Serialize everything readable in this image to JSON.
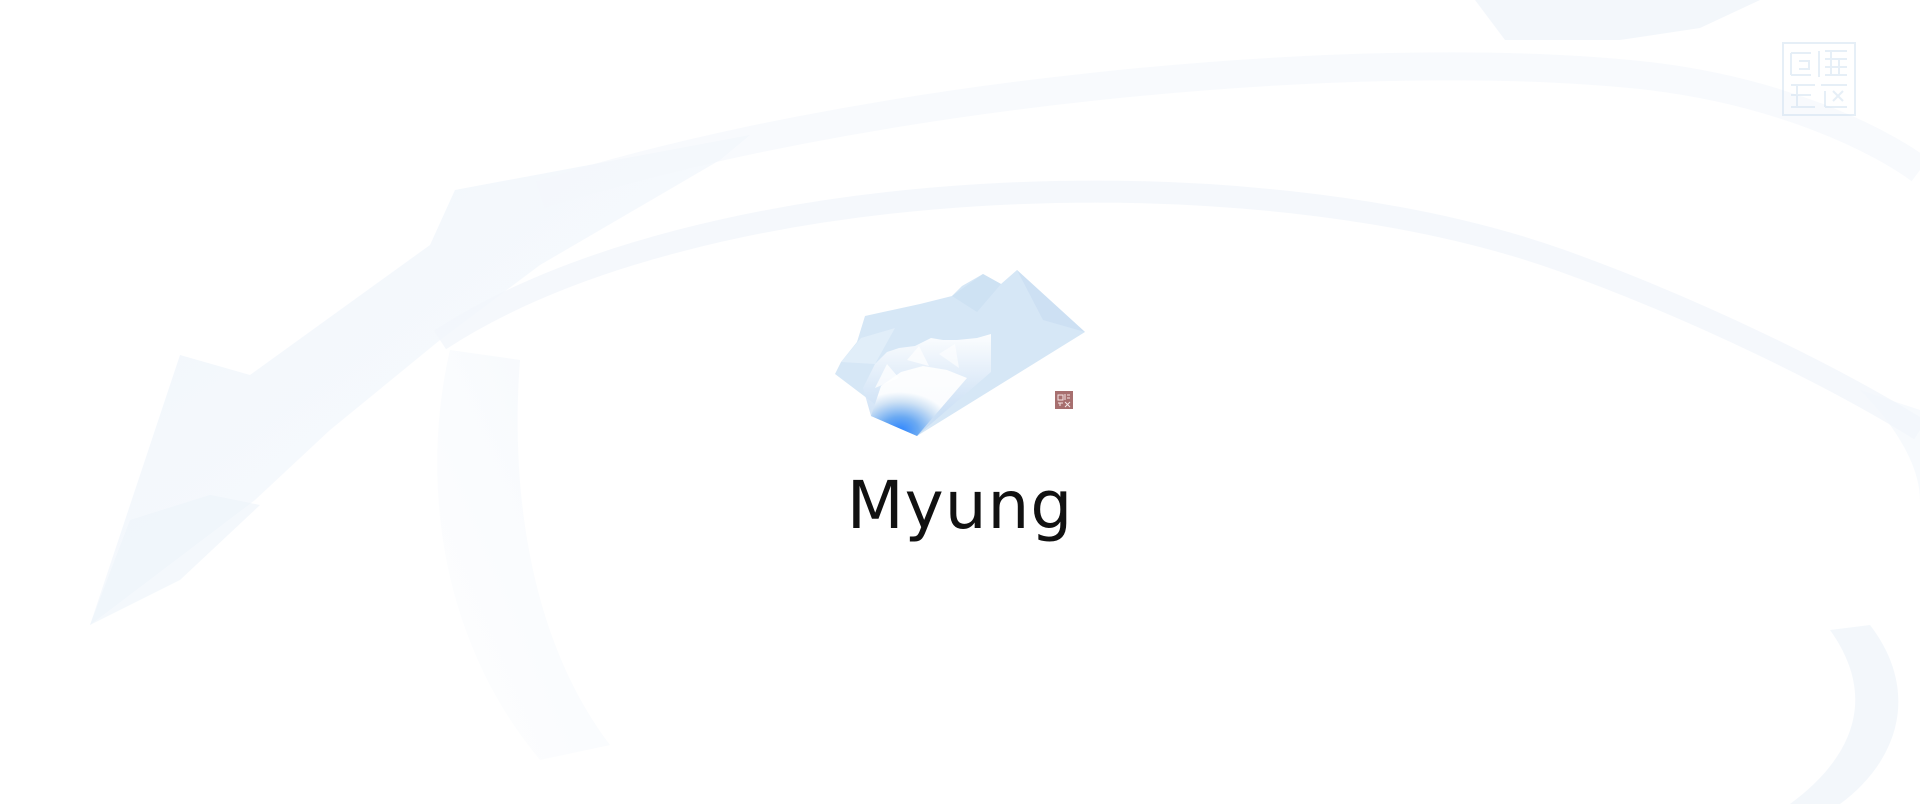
{
  "brand": {
    "name": "Myung"
  },
  "icons": {
    "logo": "lotus-shard-logo-icon",
    "corner_seal": "seal-stamp-icon",
    "mini_seal": "seal-stamp-icon"
  },
  "colors": {
    "background": "#ffffff",
    "text": "#111111",
    "logo_light": "#d4e6f6",
    "logo_core": "#2f86ff",
    "background_art": "#eef4fa",
    "mini_seal": "#a76f6f"
  }
}
